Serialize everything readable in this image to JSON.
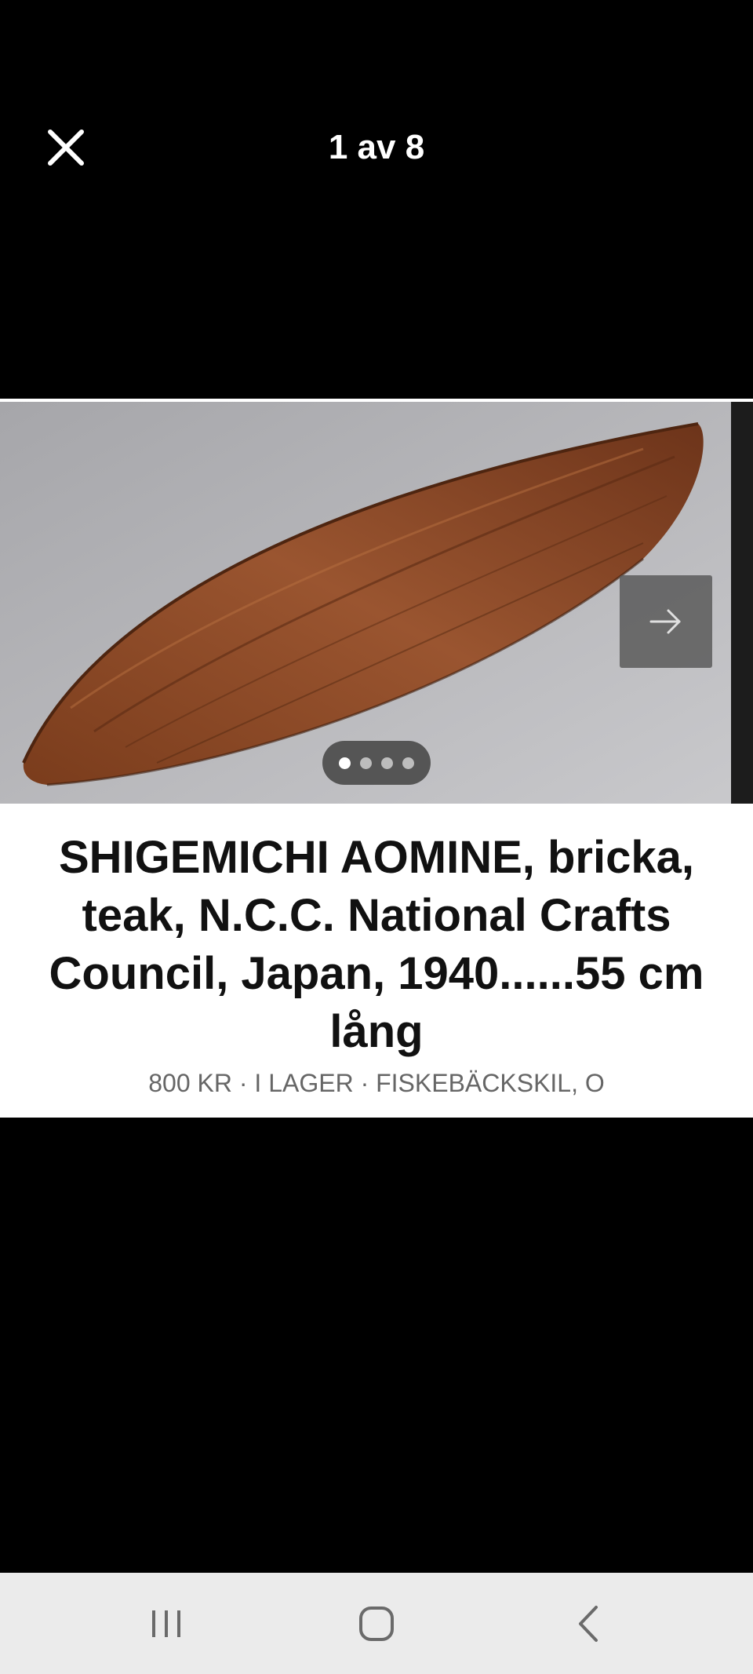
{
  "viewer": {
    "counter": "1 av 8"
  },
  "icons": {
    "close": "close-icon",
    "next": "arrow-right-icon",
    "recents": "recents-icon",
    "home": "home-icon",
    "back": "back-icon"
  },
  "carousel": {
    "total_dots": 4,
    "active_dot": 1
  },
  "listing": {
    "title": "SHIGEMICHI AOMINE, bricka, teak, N.C.C. National Crafts Council, Japan, 1940......55 cm lång",
    "meta": "800 KR · I LAGER · FISKEBÄCKSKIL, O"
  },
  "colors": {
    "background": "#000000",
    "card": "#ffffff",
    "navbar": "#ebebeb",
    "wood": "#8a4a25"
  }
}
